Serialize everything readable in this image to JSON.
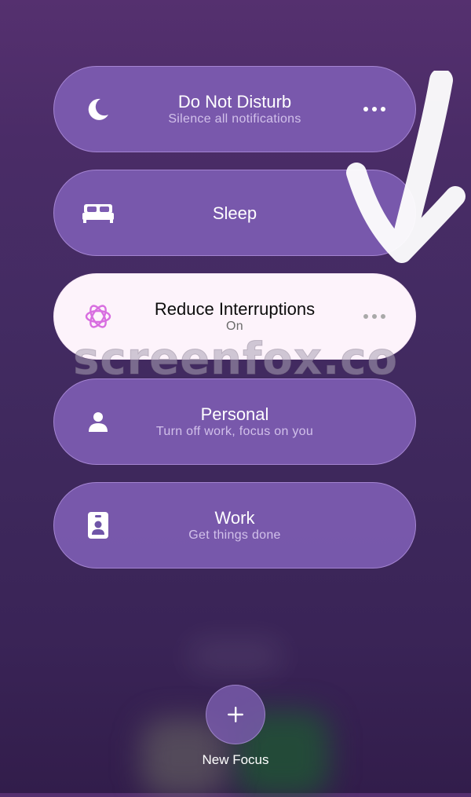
{
  "focus_modes": [
    {
      "title": "Do Not Disturb",
      "subtitle": "Silence all notifications",
      "icon": "moon-icon",
      "has_more": true,
      "active": false
    },
    {
      "title": "Sleep",
      "subtitle": "",
      "icon": "bed-icon",
      "has_more": false,
      "active": false
    },
    {
      "title": "Reduce Interruptions",
      "subtitle": "On",
      "icon": "reduce-interruptions-icon",
      "has_more": true,
      "active": true
    },
    {
      "title": "Personal",
      "subtitle": "Turn off work, focus on you",
      "icon": "person-icon",
      "has_more": false,
      "active": false
    },
    {
      "title": "Work",
      "subtitle": "Get things done",
      "icon": "id-badge-icon",
      "has_more": false,
      "active": false
    }
  ],
  "new_focus": {
    "label": "New Focus",
    "icon": "plus-icon"
  },
  "watermark": "screenfox.co",
  "colors": {
    "pill_background": "#7d5cb2",
    "active_pill_background": "#fdf3fb",
    "active_icon_color": "#d86ee0",
    "background_top": "#55306f",
    "background_bottom": "#321d4b"
  }
}
